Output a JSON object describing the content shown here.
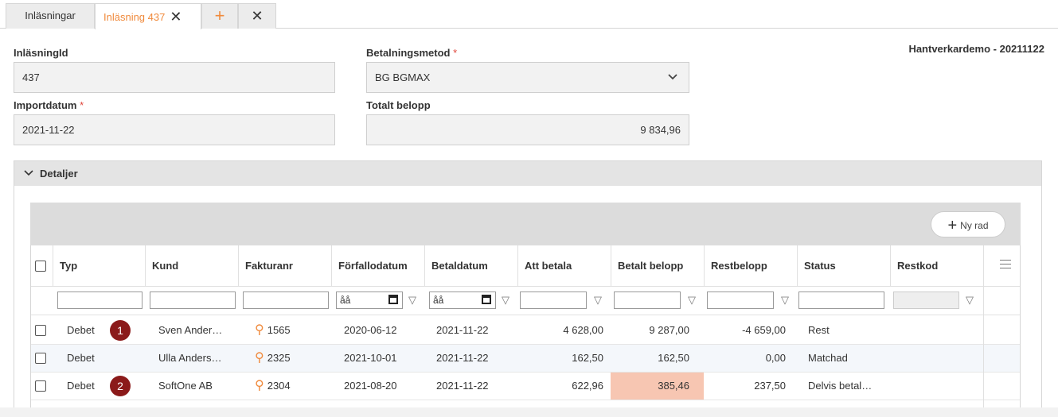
{
  "tabs": {
    "list_tab": "Inläsningar",
    "active_tab": "Inläsning 437",
    "close_glyph": "✕",
    "add_glyph": "+"
  },
  "form": {
    "id_label": "InläsningId",
    "id_value": "437",
    "payment_label": "Betalningsmetod",
    "payment_value": "BG BGMAX",
    "import_label": "Importdatum",
    "import_value": "2021-11-22",
    "total_label": "Totalt belopp",
    "total_value": "9 834,96",
    "required_mark": "*",
    "company": "Hantverkardemo - 20211122"
  },
  "section": {
    "title": "Detaljer"
  },
  "toolbar": {
    "new_row_label": "Ny rad"
  },
  "grid": {
    "columns": [
      "Typ",
      "Kund",
      "Fakturanr",
      "Förfallodatum",
      "Betaldatum",
      "Att betala",
      "Betalt belopp",
      "Restbelopp",
      "Status",
      "Restkod"
    ],
    "date_placeholder": "åå",
    "rows": [
      {
        "typ": "Debet",
        "badge": "1",
        "kund": "Sven Ander…",
        "fakturanr": "1565",
        "forfallo": "2020-06-12",
        "betaldatum": "2021-11-22",
        "att_betala": "4 628,00",
        "betalt": "9 287,00",
        "rest": "-4 659,00",
        "status": "Rest",
        "restkod": ""
      },
      {
        "typ": "Debet",
        "badge": "",
        "kund": "Ulla Anders…",
        "fakturanr": "2325",
        "forfallo": "2021-10-01",
        "betaldatum": "2021-11-22",
        "att_betala": "162,50",
        "betalt": "162,50",
        "rest": "0,00",
        "status": "Matchad",
        "restkod": ""
      },
      {
        "typ": "Debet",
        "badge": "2",
        "kund": "SoftOne AB",
        "fakturanr": "2304",
        "forfallo": "2021-08-20",
        "betaldatum": "2021-11-22",
        "att_betala": "622,96",
        "betalt": "385,46",
        "rest": "237,50",
        "status": "Delvis betal…",
        "restkod": ""
      }
    ]
  },
  "colors": {
    "accent": "#f08a3c",
    "badge": "#8b1a1a",
    "highlight": "#f7c6b2"
  }
}
